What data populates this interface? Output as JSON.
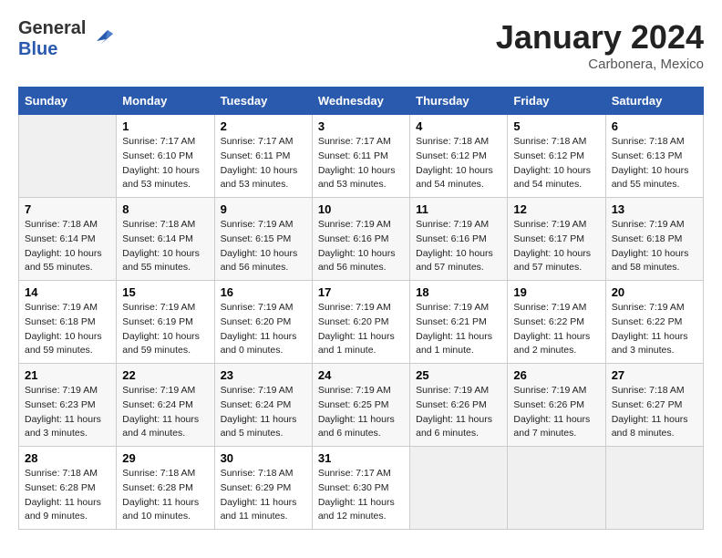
{
  "header": {
    "logo_general": "General",
    "logo_blue": "Blue",
    "title": "January 2024",
    "subtitle": "Carbonera, Mexico"
  },
  "weekdays": [
    "Sunday",
    "Monday",
    "Tuesday",
    "Wednesday",
    "Thursday",
    "Friday",
    "Saturday"
  ],
  "weeks": [
    [
      {
        "day": "",
        "sunrise": "",
        "sunset": "",
        "daylight": ""
      },
      {
        "day": "1",
        "sunrise": "7:17 AM",
        "sunset": "6:10 PM",
        "daylight": "10 hours and 53 minutes."
      },
      {
        "day": "2",
        "sunrise": "7:17 AM",
        "sunset": "6:11 PM",
        "daylight": "10 hours and 53 minutes."
      },
      {
        "day": "3",
        "sunrise": "7:17 AM",
        "sunset": "6:11 PM",
        "daylight": "10 hours and 53 minutes."
      },
      {
        "day": "4",
        "sunrise": "7:18 AM",
        "sunset": "6:12 PM",
        "daylight": "10 hours and 54 minutes."
      },
      {
        "day": "5",
        "sunrise": "7:18 AM",
        "sunset": "6:12 PM",
        "daylight": "10 hours and 54 minutes."
      },
      {
        "day": "6",
        "sunrise": "7:18 AM",
        "sunset": "6:13 PM",
        "daylight": "10 hours and 55 minutes."
      }
    ],
    [
      {
        "day": "7",
        "sunrise": "7:18 AM",
        "sunset": "6:14 PM",
        "daylight": "10 hours and 55 minutes."
      },
      {
        "day": "8",
        "sunrise": "7:18 AM",
        "sunset": "6:14 PM",
        "daylight": "10 hours and 55 minutes."
      },
      {
        "day": "9",
        "sunrise": "7:19 AM",
        "sunset": "6:15 PM",
        "daylight": "10 hours and 56 minutes."
      },
      {
        "day": "10",
        "sunrise": "7:19 AM",
        "sunset": "6:16 PM",
        "daylight": "10 hours and 56 minutes."
      },
      {
        "day": "11",
        "sunrise": "7:19 AM",
        "sunset": "6:16 PM",
        "daylight": "10 hours and 57 minutes."
      },
      {
        "day": "12",
        "sunrise": "7:19 AM",
        "sunset": "6:17 PM",
        "daylight": "10 hours and 57 minutes."
      },
      {
        "day": "13",
        "sunrise": "7:19 AM",
        "sunset": "6:18 PM",
        "daylight": "10 hours and 58 minutes."
      }
    ],
    [
      {
        "day": "14",
        "sunrise": "7:19 AM",
        "sunset": "6:18 PM",
        "daylight": "10 hours and 59 minutes."
      },
      {
        "day": "15",
        "sunrise": "7:19 AM",
        "sunset": "6:19 PM",
        "daylight": "10 hours and 59 minutes."
      },
      {
        "day": "16",
        "sunrise": "7:19 AM",
        "sunset": "6:20 PM",
        "daylight": "11 hours and 0 minutes."
      },
      {
        "day": "17",
        "sunrise": "7:19 AM",
        "sunset": "6:20 PM",
        "daylight": "11 hours and 1 minute."
      },
      {
        "day": "18",
        "sunrise": "7:19 AM",
        "sunset": "6:21 PM",
        "daylight": "11 hours and 1 minute."
      },
      {
        "day": "19",
        "sunrise": "7:19 AM",
        "sunset": "6:22 PM",
        "daylight": "11 hours and 2 minutes."
      },
      {
        "day": "20",
        "sunrise": "7:19 AM",
        "sunset": "6:22 PM",
        "daylight": "11 hours and 3 minutes."
      }
    ],
    [
      {
        "day": "21",
        "sunrise": "7:19 AM",
        "sunset": "6:23 PM",
        "daylight": "11 hours and 3 minutes."
      },
      {
        "day": "22",
        "sunrise": "7:19 AM",
        "sunset": "6:24 PM",
        "daylight": "11 hours and 4 minutes."
      },
      {
        "day": "23",
        "sunrise": "7:19 AM",
        "sunset": "6:24 PM",
        "daylight": "11 hours and 5 minutes."
      },
      {
        "day": "24",
        "sunrise": "7:19 AM",
        "sunset": "6:25 PM",
        "daylight": "11 hours and 6 minutes."
      },
      {
        "day": "25",
        "sunrise": "7:19 AM",
        "sunset": "6:26 PM",
        "daylight": "11 hours and 6 minutes."
      },
      {
        "day": "26",
        "sunrise": "7:19 AM",
        "sunset": "6:26 PM",
        "daylight": "11 hours and 7 minutes."
      },
      {
        "day": "27",
        "sunrise": "7:18 AM",
        "sunset": "6:27 PM",
        "daylight": "11 hours and 8 minutes."
      }
    ],
    [
      {
        "day": "28",
        "sunrise": "7:18 AM",
        "sunset": "6:28 PM",
        "daylight": "11 hours and 9 minutes."
      },
      {
        "day": "29",
        "sunrise": "7:18 AM",
        "sunset": "6:28 PM",
        "daylight": "11 hours and 10 minutes."
      },
      {
        "day": "30",
        "sunrise": "7:18 AM",
        "sunset": "6:29 PM",
        "daylight": "11 hours and 11 minutes."
      },
      {
        "day": "31",
        "sunrise": "7:17 AM",
        "sunset": "6:30 PM",
        "daylight": "11 hours and 12 minutes."
      },
      {
        "day": "",
        "sunrise": "",
        "sunset": "",
        "daylight": ""
      },
      {
        "day": "",
        "sunrise": "",
        "sunset": "",
        "daylight": ""
      },
      {
        "day": "",
        "sunrise": "",
        "sunset": "",
        "daylight": ""
      }
    ]
  ]
}
